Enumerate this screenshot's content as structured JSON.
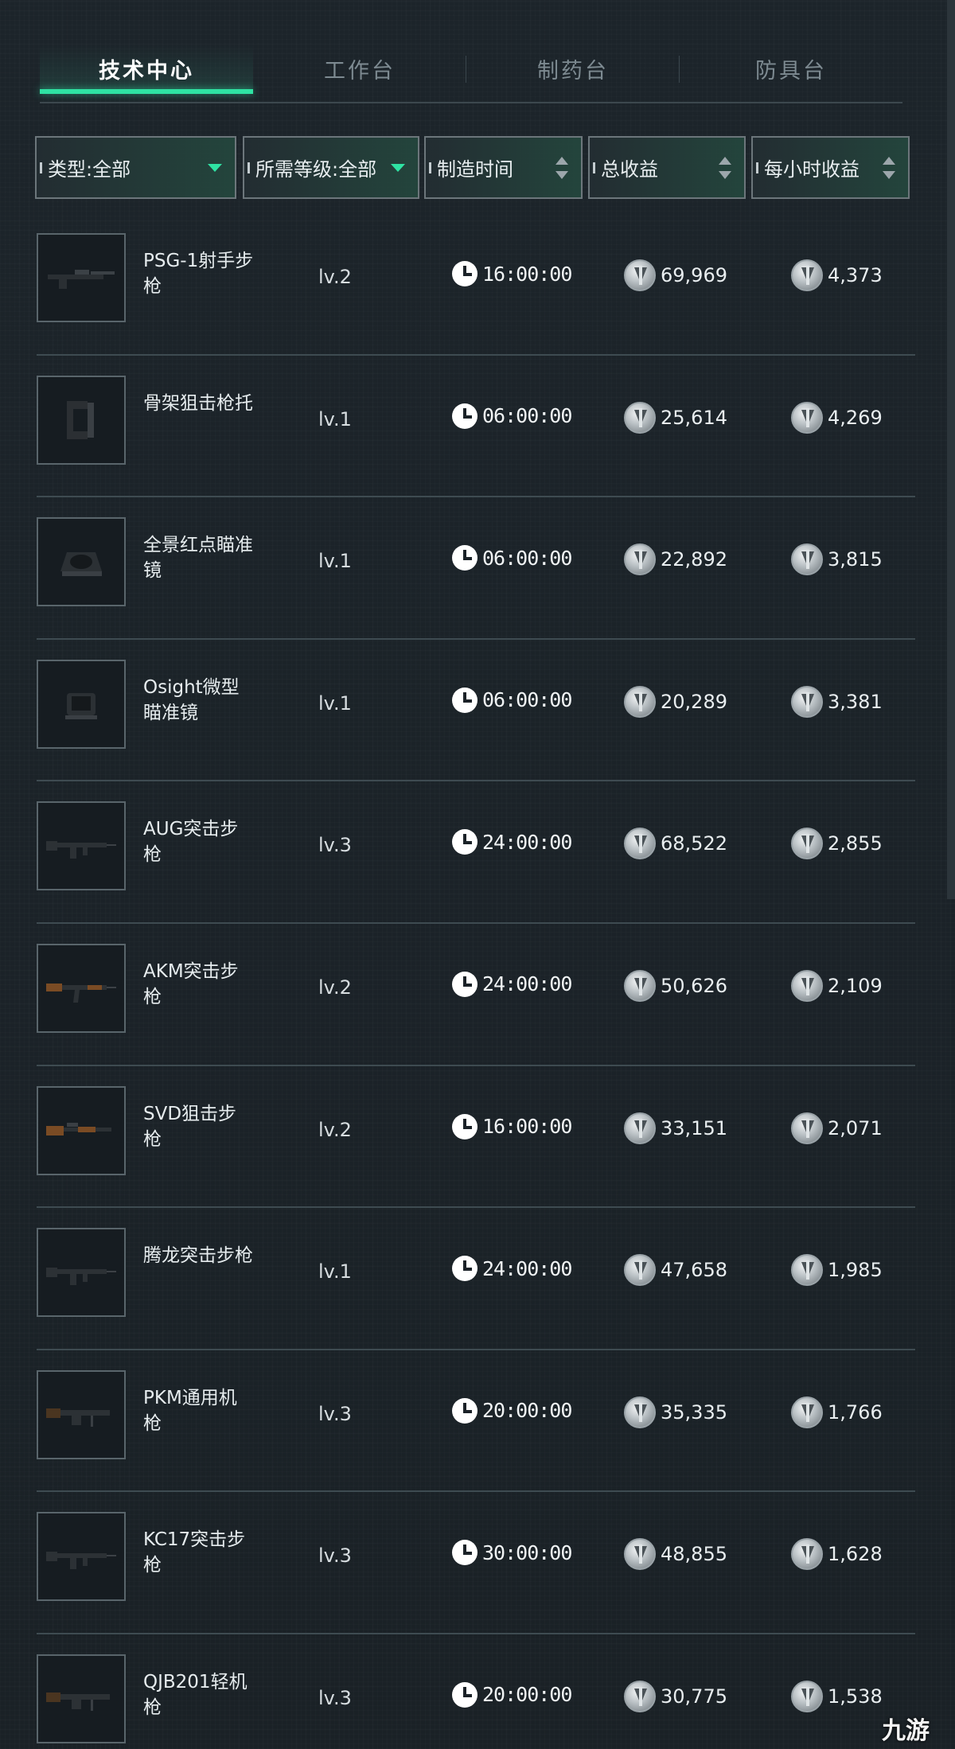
{
  "tabs": [
    {
      "label": "技术中心",
      "active": true
    },
    {
      "label": "工作台",
      "active": false
    },
    {
      "label": "制药台",
      "active": false
    },
    {
      "label": "防具台",
      "active": false
    }
  ],
  "filters": {
    "type": "类型:全部",
    "level": "所需等级:全部",
    "time": "制造时间",
    "total": "总收益",
    "hourly": "每小时收益"
  },
  "colors": {
    "accent": "#2fe3a3",
    "background": "#1b2228",
    "divider": "#3e4b51"
  },
  "icons": {
    "time": "clock-icon",
    "currency": "coin-icon",
    "filter": "caret-down-icon",
    "sort": "sort-icon"
  },
  "items": [
    {
      "name": "PSG-1射手步枪",
      "level": "lv.2",
      "time": "16:00:00",
      "total": "69,969",
      "hourly": "4,373",
      "image": "sniper-rifle"
    },
    {
      "name": "骨架狙击枪托",
      "level": "lv.1",
      "time": "06:00:00",
      "total": "25,614",
      "hourly": "4,269",
      "image": "stock"
    },
    {
      "name": "全景红点瞄准镜",
      "level": "lv.1",
      "time": "06:00:00",
      "total": "22,892",
      "hourly": "3,815",
      "image": "red-dot-sight"
    },
    {
      "name": "Osight微型瞄准镜",
      "level": "lv.1",
      "time": "06:00:00",
      "total": "20,289",
      "hourly": "3,381",
      "image": "micro-sight"
    },
    {
      "name": "AUG突击步枪",
      "level": "lv.3",
      "time": "24:00:00",
      "total": "68,522",
      "hourly": "2,855",
      "image": "assault-rifle"
    },
    {
      "name": "AKM突击步枪",
      "level": "lv.2",
      "time": "24:00:00",
      "total": "50,626",
      "hourly": "2,109",
      "image": "akm-rifle"
    },
    {
      "name": "SVD狙击步枪",
      "level": "lv.2",
      "time": "16:00:00",
      "total": "33,151",
      "hourly": "2,071",
      "image": "svd-rifle"
    },
    {
      "name": "腾龙突击步枪",
      "level": "lv.1",
      "time": "24:00:00",
      "total": "47,658",
      "hourly": "1,985",
      "image": "assault-rifle"
    },
    {
      "name": "PKM通用机枪",
      "level": "lv.3",
      "time": "20:00:00",
      "total": "35,335",
      "hourly": "1,766",
      "image": "machine-gun"
    },
    {
      "name": "KC17突击步枪",
      "level": "lv.3",
      "time": "30:00:00",
      "total": "48,855",
      "hourly": "1,628",
      "image": "assault-rifle"
    },
    {
      "name": "QJB201轻机枪",
      "level": "lv.3",
      "time": "20:00:00",
      "total": "30,775",
      "hourly": "1,538",
      "image": "machine-gun"
    }
  ],
  "watermark": "九游"
}
